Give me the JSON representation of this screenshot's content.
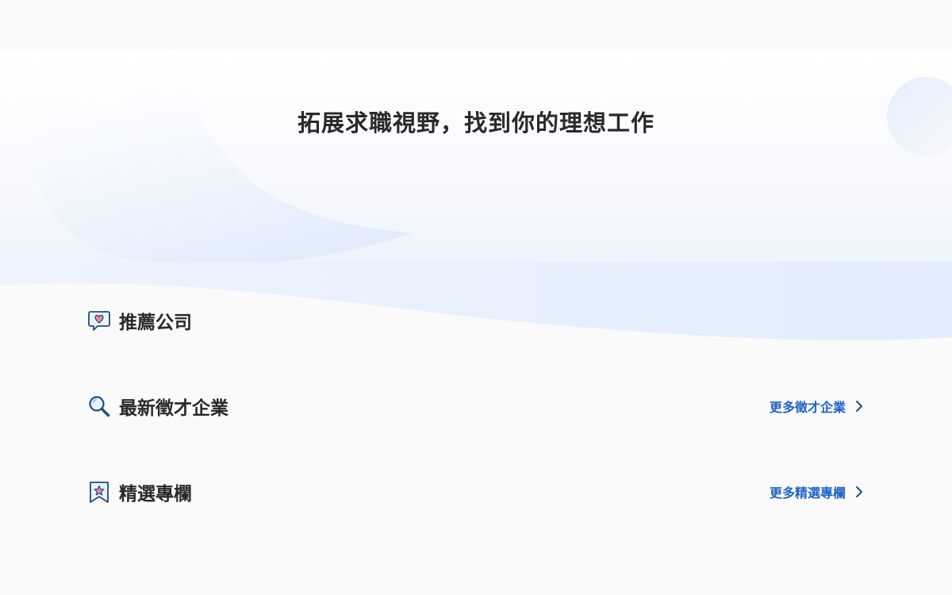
{
  "hero": {
    "title": "拓展求職視野，找到你的理想工作"
  },
  "sections": [
    {
      "title": "推薦公司",
      "icon": "heart-speech-bubble-icon"
    },
    {
      "title": "最新徵才企業",
      "icon": "magnifier-icon",
      "more_label": "更多徵才企業"
    },
    {
      "title": "精選專欄",
      "icon": "star-bookmark-icon",
      "more_label": "更多精選專欄"
    }
  ],
  "colors": {
    "page_background": "#fafafa",
    "hero_gradient": "#e3eefc",
    "title_text": "#292929",
    "link": "#1f63c6",
    "icon_outline": "#1f4e7e",
    "icon_pink": "#f08a9c"
  }
}
